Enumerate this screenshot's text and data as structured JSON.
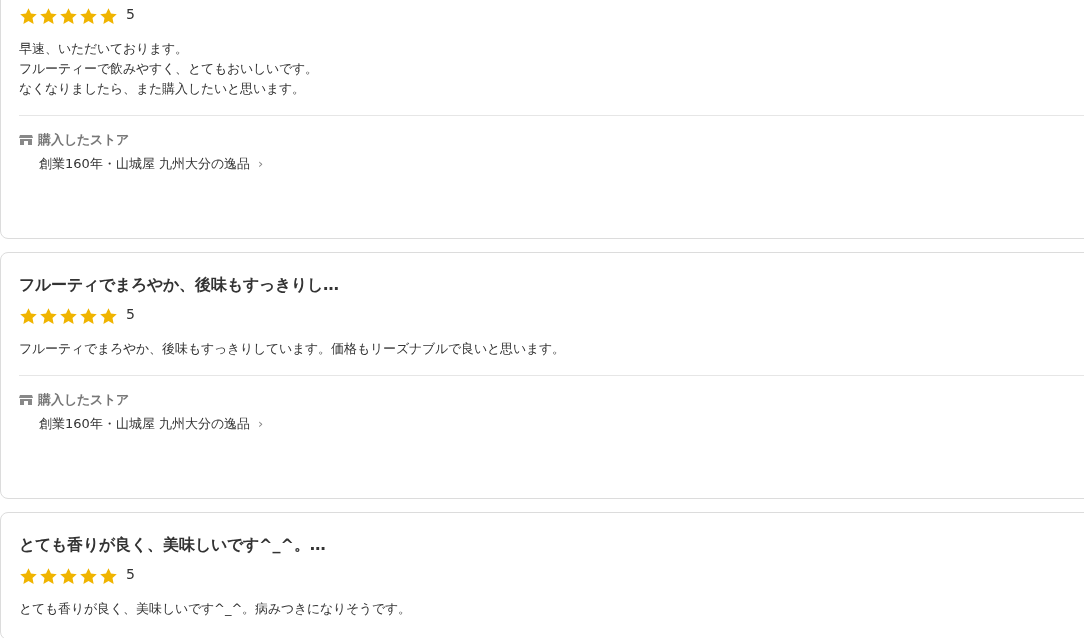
{
  "reviews": [
    {
      "stars": 5,
      "rating": "5",
      "body": [
        "早速、いただいております。",
        "フルーティーで飲みやすく、とてもおいしいです。",
        "なくなりましたら、また購入したいと思います。"
      ],
      "store_label": "購入したストア",
      "store_name": "創業160年・山城屋 九州大分の逸品",
      "store_arrow": "›"
    },
    {
      "title": "フルーティでまろやか、後味もすっきりし…",
      "stars": 5,
      "rating": "5",
      "body": [
        "フルーティでまろやか、後味もすっきりしています。価格もリーズナブルで良いと思います。"
      ],
      "store_label": "購入したストア",
      "store_name": "創業160年・山城屋 九州大分の逸品",
      "store_arrow": "›"
    },
    {
      "title": "とても香りが良く、美味しいです^_^。…",
      "stars": 5,
      "rating": "5",
      "body": [
        "とても香りが良く、美味しいです^_^。病みつきになりそうです。"
      ]
    }
  ]
}
